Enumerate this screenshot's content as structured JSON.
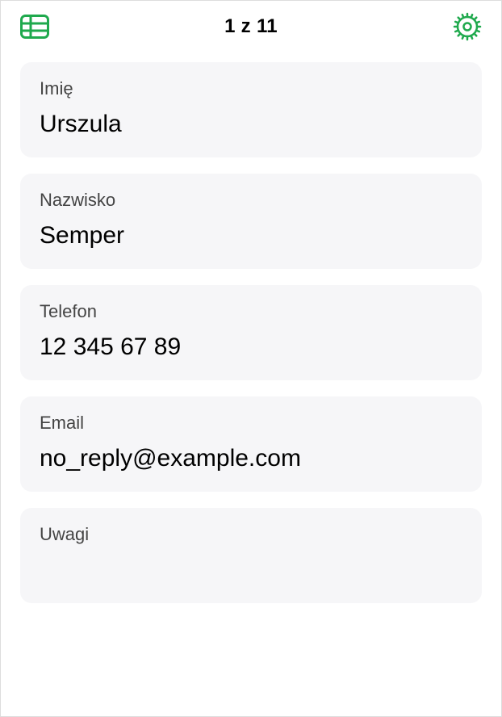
{
  "header": {
    "title": "1 z 11"
  },
  "fields": [
    {
      "label": "Imię",
      "value": "Urszula"
    },
    {
      "label": "Nazwisko",
      "value": "Semper"
    },
    {
      "label": "Telefon",
      "value": "12 345 67 89"
    },
    {
      "label": "Email",
      "value": "no_reply@example.com"
    },
    {
      "label": "Uwagi",
      "value": ""
    }
  ],
  "colors": {
    "accent": "#1fa94d"
  }
}
